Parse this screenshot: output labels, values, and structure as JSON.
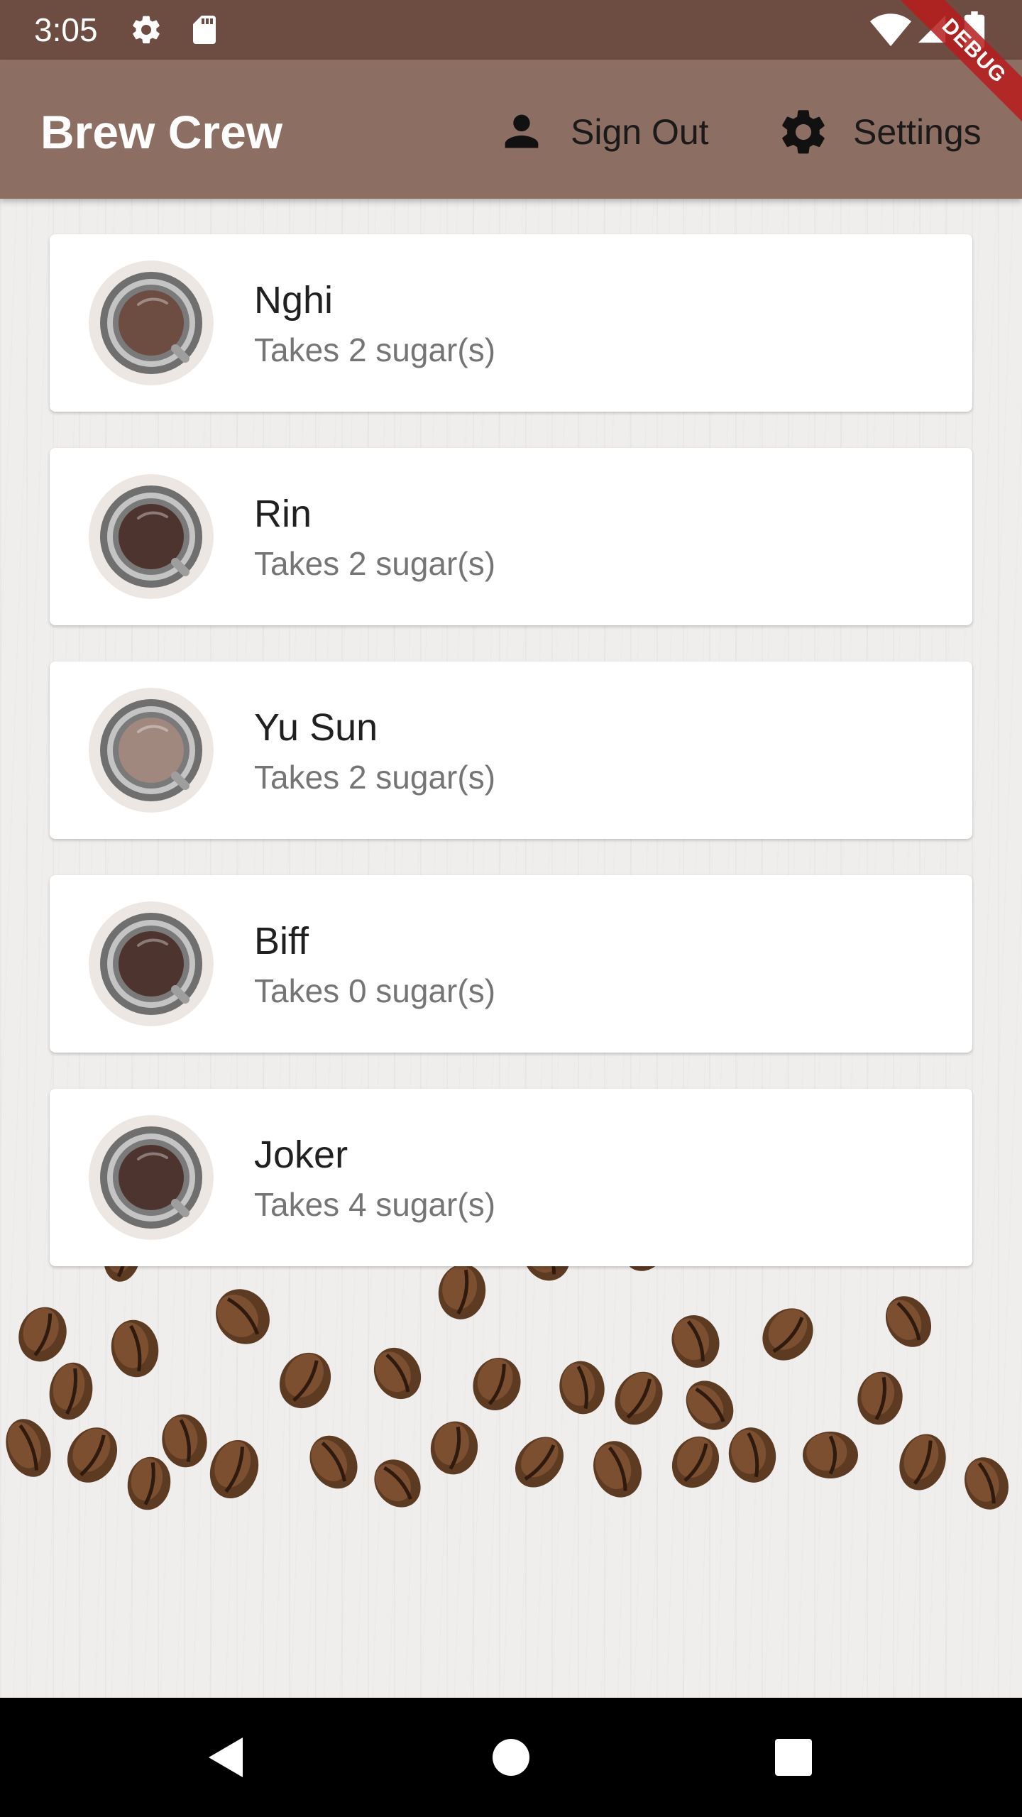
{
  "status_bar": {
    "time": "3:05",
    "icons": [
      "settings-icon",
      "sd-card-icon",
      "wifi-icon",
      "cell-signal-icon",
      "battery-icon"
    ]
  },
  "debug_banner": "DEBUG",
  "app_bar": {
    "title": "Brew Crew",
    "background_color": "#8d6e63",
    "status_color": "#6d4c41",
    "sign_out_label": "Sign Out",
    "settings_label": "Settings"
  },
  "brews": [
    {
      "name": "Nghi",
      "subtitle": "Takes 2 sugar(s)",
      "coffee_color": "#6d4c41"
    },
    {
      "name": "Rin",
      "subtitle": "Takes 2 sugar(s)",
      "coffee_color": "#4e342e"
    },
    {
      "name": "Yu Sun",
      "subtitle": "Takes 2 sugar(s)",
      "coffee_color": "#a1887f"
    },
    {
      "name": "Biff",
      "subtitle": "Takes 0 sugar(s)",
      "coffee_color": "#4e342e"
    },
    {
      "name": "Joker",
      "subtitle": "Takes 4 sugar(s)",
      "coffee_color": "#4e342e"
    }
  ],
  "nav_bar": {
    "icons": [
      "back-icon",
      "home-icon",
      "recents-icon"
    ]
  }
}
